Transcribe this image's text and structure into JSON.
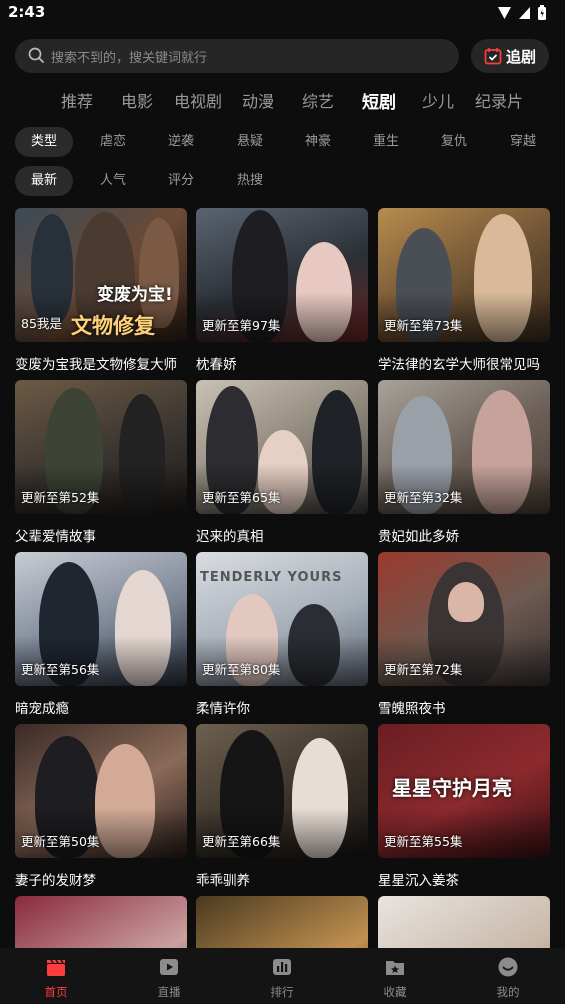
{
  "status": {
    "time": "2:43"
  },
  "search": {
    "placeholder": "搜索不到的，搜关键词就行",
    "follow_label": "追剧"
  },
  "tabs": [
    "推荐",
    "电影",
    "电视剧",
    "动漫",
    "综艺",
    "短剧",
    "少儿",
    "纪录片"
  ],
  "active_tab": "短剧",
  "genres": [
    "类型",
    "虐恋",
    "逆袭",
    "悬疑",
    "神豪",
    "重生",
    "复仇",
    "穿越"
  ],
  "sorts": [
    "最新",
    "人气",
    "评分",
    "热搜"
  ],
  "cards": [
    {
      "title": "变废为宝我是文物修复大师",
      "episode": "85我是",
      "poster_text": "文物修复",
      "poster_text2": "变废为宝!"
    },
    {
      "title": "枕春娇",
      "episode": "更新至第97集"
    },
    {
      "title": "学法律的玄学大师很常见吗",
      "episode": "更新至第73集"
    },
    {
      "title": "父辈爱情故事",
      "episode": "更新至第52集"
    },
    {
      "title": "迟来的真相",
      "episode": "更新至第65集"
    },
    {
      "title": "贵妃如此多娇",
      "episode": "更新至第32集"
    },
    {
      "title": "暗宠成瘾",
      "episode": "更新至第56集"
    },
    {
      "title": "柔情许你",
      "episode": "更新至第80集",
      "poster_text": "TENDERLY YOURS"
    },
    {
      "title": "雪魄照夜书",
      "episode": "更新至第72集"
    },
    {
      "title": "妻子的发财梦",
      "episode": "更新至第50集"
    },
    {
      "title": "乖乖驯养",
      "episode": "更新至第66集"
    },
    {
      "title": "星星沉入姜茶",
      "episode": "更新至第55集",
      "poster_text": "星星守护月亮"
    },
    {
      "title": "",
      "episode": ""
    },
    {
      "title": "",
      "episode": ""
    },
    {
      "title": "",
      "episode": ""
    }
  ],
  "bottom_nav": [
    "首页",
    "直播",
    "排行",
    "收藏",
    "我的"
  ],
  "colors": {
    "accent": "#ff3d3d",
    "background": "#0d0d0d",
    "surface": "#262626"
  }
}
